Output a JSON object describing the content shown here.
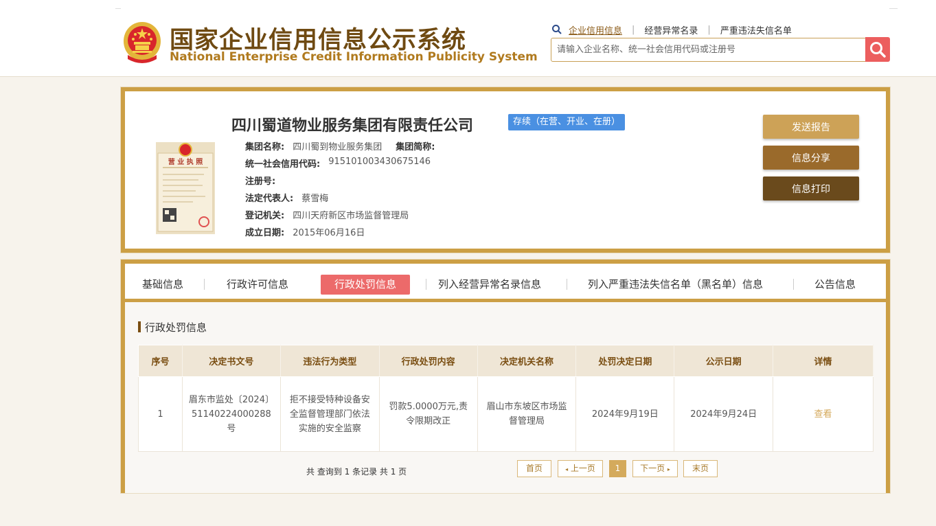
{
  "header": {
    "title_cn": "国家企业信用信息公示系统",
    "title_en": "National Enterprise Credit Information Publicity System",
    "nav": [
      "企业信用信息",
      "经营异常名录",
      "严重违法失信名单"
    ],
    "search_placeholder": "请输入企业名称、统一社会信用代码或注册号"
  },
  "company": {
    "name": "四川蜀道物业服务集团有限责任公司",
    "status": "存续（在营、开业、在册）",
    "group_name_label": "集团名称:",
    "group_name": "四川蜀到物业服务集团",
    "group_abbr_label": "集团简称:",
    "credit_code_label": "统一社会信用代码:",
    "credit_code": "915101003430675146",
    "reg_no_label": "注册号:",
    "legal_rep_label": "法定代表人:",
    "legal_rep": "蔡雪梅",
    "authority_label": "登记机关:",
    "authority": "四川天府新区市场监督管理局",
    "founded_label": "成立日期:",
    "founded": "2015年06月16日",
    "license_title": "营 业 执 照"
  },
  "actions": {
    "send_report": "发送报告",
    "share": "信息分享",
    "print": "信息打印"
  },
  "tabs": [
    "基础信息",
    "行政许可信息",
    "行政处罚信息",
    "列入经营异常名录信息",
    "列入严重违法失信名单（黑名单）信息",
    "公告信息"
  ],
  "section": {
    "title": "行政处罚信息",
    "columns": [
      "序号",
      "决定书文号",
      "违法行为类型",
      "行政处罚内容",
      "决定机关名称",
      "处罚决定日期",
      "公示日期",
      "详情"
    ],
    "rows": [
      {
        "no": "1",
        "doc": "眉东市监处〔2024〕51140224000288号",
        "type": "拒不接受特种设备安全监督管理部门依法实施的安全监察",
        "content": "罚款5.0000万元,责令限期改正",
        "org": "眉山市东坡区市场监督管理局",
        "decision_date": "2024年9月19日",
        "publish_date": "2024年9月24日",
        "detail": "查看"
      }
    ]
  },
  "pager": {
    "info": "共 查询到 1 条记录 共 1 页",
    "first": "首页",
    "prev": "上一页",
    "current": "1",
    "next": "下一页",
    "last": "末页"
  },
  "colors": {
    "gold_border": "#cc9f45",
    "brown_title": "#6f4a12",
    "status_blue": "#4a90e2",
    "active_tab": "#ec6a6a",
    "btn_send": "#cda257",
    "btn_share": "#9a6a2b",
    "btn_print": "#6a4a1c"
  }
}
